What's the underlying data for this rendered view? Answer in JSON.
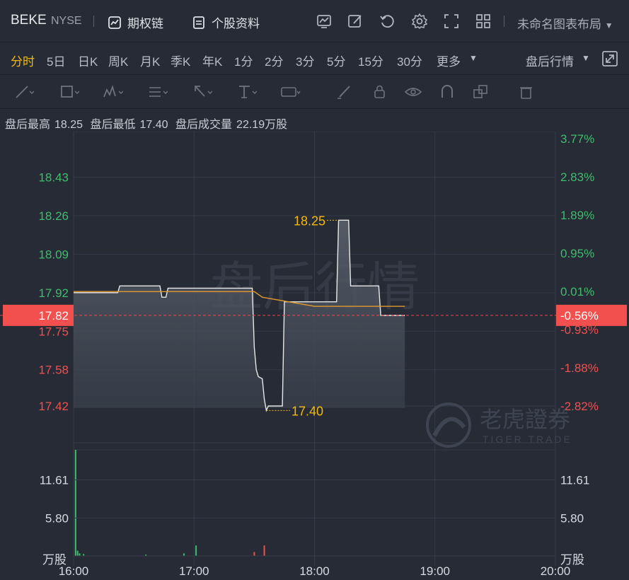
{
  "header": {
    "ticker": "BEKE",
    "exchange": "NYSE",
    "options_chain": "期权链",
    "profile": "个股资料",
    "layout_name": "未命名图表布局"
  },
  "periods": [
    "分时",
    "5日",
    "日K",
    "周K",
    "月K",
    "季K",
    "年K",
    "1分",
    "2分",
    "3分",
    "5分",
    "15分",
    "30分",
    "更多"
  ],
  "active_period": "分时",
  "after_hours_label": "盘后行情",
  "stats": {
    "high_label": "盘后最高",
    "high": "18.25",
    "low_label": "盘后最低",
    "low": "17.40",
    "vol_label": "盘后成交量",
    "vol": "22.19万股"
  },
  "watermark": "盘后行情",
  "brand": {
    "cn": "老虎證券",
    "en": "TIGER TRADE"
  },
  "colors": {
    "up": "#3fbd6d",
    "down": "#f2504f",
    "accent": "#f2b90c",
    "line": "#e8e8e8",
    "avg": "#e39a2e"
  },
  "chart_data": {
    "type": "line",
    "x_ticks": [
      "16:00",
      "17:00",
      "18:00",
      "19:00",
      "20:00"
    ],
    "x_range_minutes": [
      0,
      240
    ],
    "y_ticks_left": [
      "18.43",
      "18.26",
      "18.09",
      "17.92",
      "17.75",
      "17.58",
      "17.42"
    ],
    "y_ticks_right": [
      "3.77%",
      "2.83%",
      "1.89%",
      "0.95%",
      "0.01%",
      "-0.93%",
      "-1.88%",
      "-2.82%"
    ],
    "ylim": [
      17.42,
      18.6
    ],
    "reference_price": "17.82",
    "reference_pct": "-0.56%",
    "max_label": "18.25",
    "min_label": "17.40",
    "price": [
      [
        0,
        17.92
      ],
      [
        22,
        17.92
      ],
      [
        23,
        17.95
      ],
      [
        43,
        17.95
      ],
      [
        44,
        17.9
      ],
      [
        46,
        17.9
      ],
      [
        47,
        17.94
      ],
      [
        89,
        17.94
      ],
      [
        90,
        17.68
      ],
      [
        91,
        17.58
      ],
      [
        92,
        17.55
      ],
      [
        94,
        17.54
      ],
      [
        95,
        17.45
      ],
      [
        96,
        17.4
      ],
      [
        97,
        17.42
      ],
      [
        104,
        17.42
      ],
      [
        105,
        17.88
      ],
      [
        120,
        17.88
      ],
      [
        123,
        17.88
      ],
      [
        131,
        17.88
      ],
      [
        132,
        18.24
      ],
      [
        137,
        18.24
      ],
      [
        138,
        17.95
      ],
      [
        152,
        17.95
      ],
      [
        153,
        17.82
      ],
      [
        165,
        17.82
      ]
    ],
    "avg_price": [
      [
        0,
        17.925
      ],
      [
        90,
        17.925
      ],
      [
        94,
        17.9
      ],
      [
        120,
        17.86
      ],
      [
        165,
        17.86
      ]
    ],
    "volume_axis": [
      "11.61",
      "5.80"
    ],
    "volume_unit": "万股",
    "volume_ymax": 16.2,
    "volume": [
      [
        1,
        16.2,
        "up"
      ],
      [
        2,
        0.8,
        "up"
      ],
      [
        3,
        0.4,
        "up"
      ],
      [
        5,
        0.3,
        "up"
      ],
      [
        36,
        0.2,
        "up"
      ],
      [
        55,
        0.4,
        "up"
      ],
      [
        61,
        1.6,
        "up"
      ],
      [
        90,
        0.6,
        "down"
      ],
      [
        95,
        1.6,
        "down"
      ]
    ]
  }
}
